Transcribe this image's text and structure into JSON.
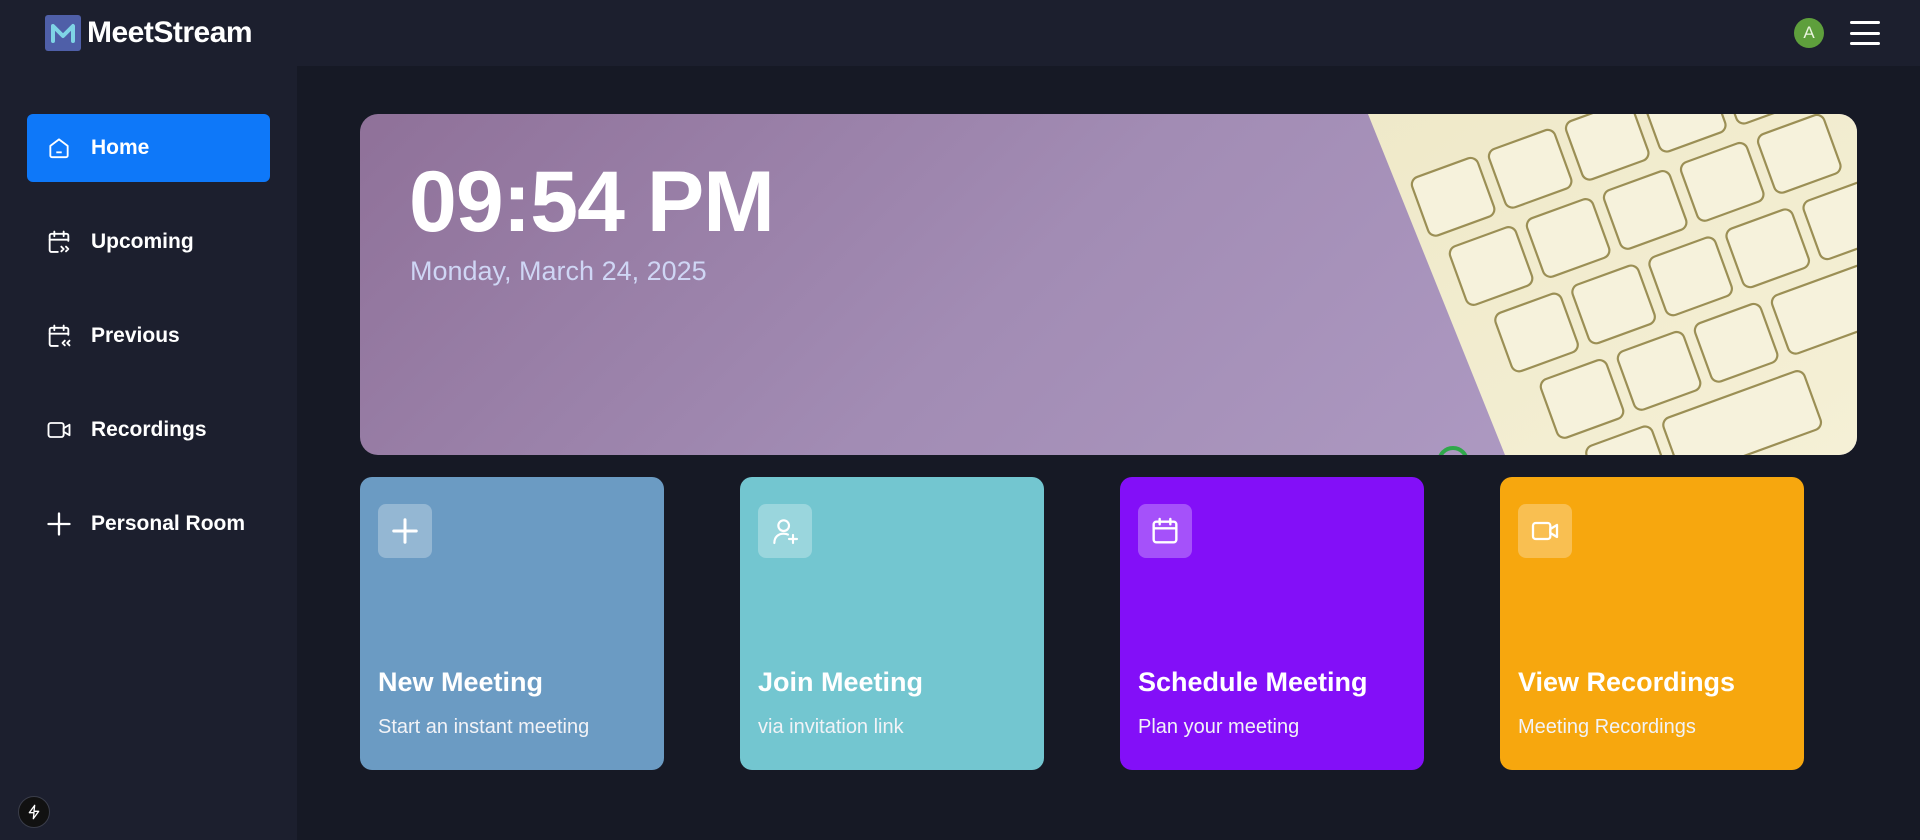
{
  "header": {
    "brand_name": "MeetStream",
    "logo_icon": "meetstream-logo-icon",
    "avatar_initial": "A",
    "avatar_color": "#5e9f3c"
  },
  "sidebar": {
    "items": [
      {
        "label": "Home",
        "icon": "home-icon",
        "active": true
      },
      {
        "label": "Upcoming",
        "icon": "calendar-forward-icon",
        "active": false
      },
      {
        "label": "Previous",
        "icon": "calendar-back-icon",
        "active": false
      },
      {
        "label": "Recordings",
        "icon": "video-icon",
        "active": false
      },
      {
        "label": "Personal Room",
        "icon": "plus-icon",
        "active": false
      }
    ],
    "accent": "#0e78f9"
  },
  "hero": {
    "time": "09:54 PM",
    "date": "Monday, March 24, 2025"
  },
  "cards": [
    {
      "title": "New Meeting",
      "subtitle": "Start an instant meeting",
      "icon": "plus-icon",
      "color": "#6b9bc3"
    },
    {
      "title": "Join Meeting",
      "subtitle": "via invitation link",
      "icon": "user-plus-icon",
      "color": "#73c6d0"
    },
    {
      "title": "Schedule Meeting",
      "subtitle": "Plan your meeting",
      "icon": "calendar-icon",
      "color": "#830ff8"
    },
    {
      "title": "View Recordings",
      "subtitle": "Meeting Recordings",
      "icon": "video-icon",
      "color": "#f7a70e"
    }
  ]
}
